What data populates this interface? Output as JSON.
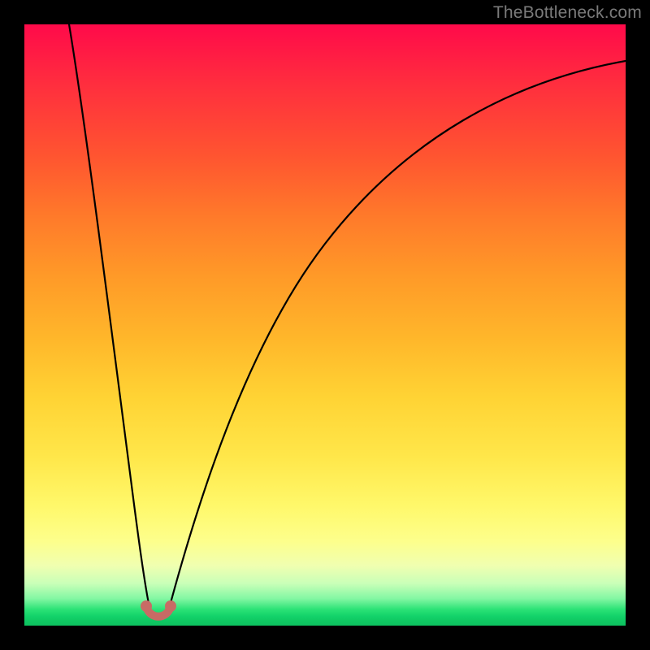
{
  "watermark": "TheBottleneck.com",
  "chart_data": {
    "type": "line",
    "title": "",
    "xlabel": "",
    "ylabel": "",
    "xlim": [
      0,
      100
    ],
    "ylim": [
      0,
      100
    ],
    "grid": false,
    "legend": false,
    "background_gradient": {
      "direction": "vertical",
      "stops": [
        {
          "pos": 0.0,
          "color": "#ff0a4a"
        },
        {
          "pos": 0.5,
          "color": "#ffb62a"
        },
        {
          "pos": 0.8,
          "color": "#fff86a"
        },
        {
          "pos": 0.97,
          "color": "#2be276"
        },
        {
          "pos": 1.0,
          "color": "#0dc260"
        }
      ]
    },
    "series": [
      {
        "name": "bottleneck-curve",
        "color": "#000000",
        "x": [
          0,
          3,
          6,
          9,
          12,
          15,
          17,
          19,
          20.5,
          22,
          25,
          30,
          38,
          48,
          60,
          75,
          90,
          100
        ],
        "y": [
          100,
          87,
          73,
          59,
          44,
          28,
          14,
          4,
          0.5,
          4,
          18,
          36,
          55,
          70,
          81,
          89,
          94,
          96
        ]
      }
    ],
    "markers": [
      {
        "name": "left-dot",
        "x": 19.5,
        "y": 1.5,
        "color": "#c86b65"
      },
      {
        "name": "right-dot",
        "x": 22.8,
        "y": 1.5,
        "color": "#c86b65"
      }
    ],
    "highlight_segment": {
      "x_range": [
        19.5,
        22.8
      ],
      "y": 0.7,
      "color": "#c86b65"
    }
  }
}
